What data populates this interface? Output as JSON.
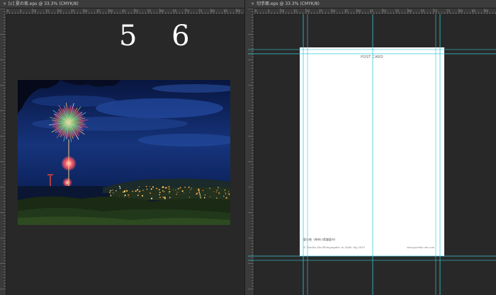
{
  "left_document": {
    "tab_close": "×",
    "tab_title": "[c] 夏の夜.eps @ 33.3% (CMYK/8)",
    "page_number": "5 6",
    "photo": {
      "subject": "fireworks over coastal town at night"
    }
  },
  "right_document": {
    "tab_close": "×",
    "tab_title": "切手面.eps @ 33.3% (CMYK/8)",
    "postcard": {
      "header": "POST CARD",
      "caption": "夏の夜（神奈川県鎌倉市）",
      "credit": "© Yumiko Ota Photographer, in Zushi city 2019",
      "url": "www.yumiko-ota.com"
    }
  },
  "colors": {
    "workspace": "#282828",
    "guide": "#37c9d8",
    "sky_top": "#0a1a4a",
    "sky_bottom": "#1a3c8a"
  },
  "rulers": {
    "top_ticks_left": [
      "0",
      "5",
      "10",
      "15",
      "20",
      "25",
      "30",
      "35",
      "40",
      "45",
      "50",
      "55",
      "60",
      "65",
      "70",
      "75",
      "80",
      "85",
      "90"
    ],
    "top_ticks_right": [
      "0",
      "5",
      "10",
      "15",
      "20",
      "25",
      "30",
      "35",
      "40",
      "45",
      "50",
      "55",
      "60",
      "65",
      "70",
      "75",
      "80",
      "85",
      "90"
    ]
  }
}
